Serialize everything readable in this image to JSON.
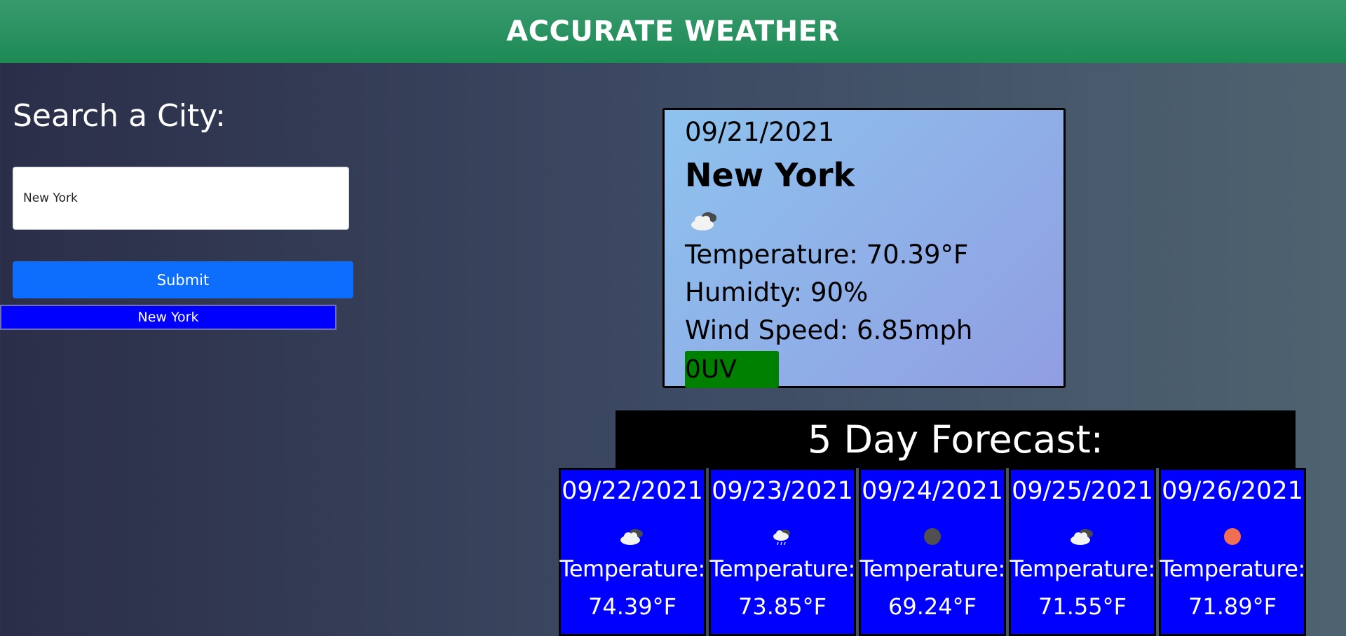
{
  "header": {
    "title": "ACCURATE WEATHER",
    "color": "#1d8a54"
  },
  "search": {
    "title": "Search a City:",
    "input_value": "New York",
    "submit_label": "Submit",
    "history": [
      "New York"
    ]
  },
  "current": {
    "date": "09/21/2021",
    "city": "New York",
    "icon": "broken-clouds-icon",
    "temperature": "Temperature: 70.39°F",
    "humidity": "Humidty: 90%",
    "wind": "Wind Speed: 6.85mph",
    "uv": "0UV",
    "uv_color": "#008000"
  },
  "forecast": {
    "title": "5 Day Forecast:",
    "days": [
      {
        "date": "09/22/2021",
        "icon": "broken-clouds-icon",
        "label": "Temperature:",
        "temp": "74.39°F"
      },
      {
        "date": "09/23/2021",
        "icon": "rain-cloud-icon",
        "label": "Temperature:",
        "temp": "73.85°F"
      },
      {
        "date": "09/24/2021",
        "icon": "overcast-icon",
        "label": "Temperature:",
        "temp": "69.24°F"
      },
      {
        "date": "09/25/2021",
        "icon": "broken-clouds-icon",
        "label": "Temperature:",
        "temp": "71.55°F"
      },
      {
        "date": "09/26/2021",
        "icon": "sun-icon",
        "label": "Temperature:",
        "temp": "71.89°F"
      }
    ]
  }
}
